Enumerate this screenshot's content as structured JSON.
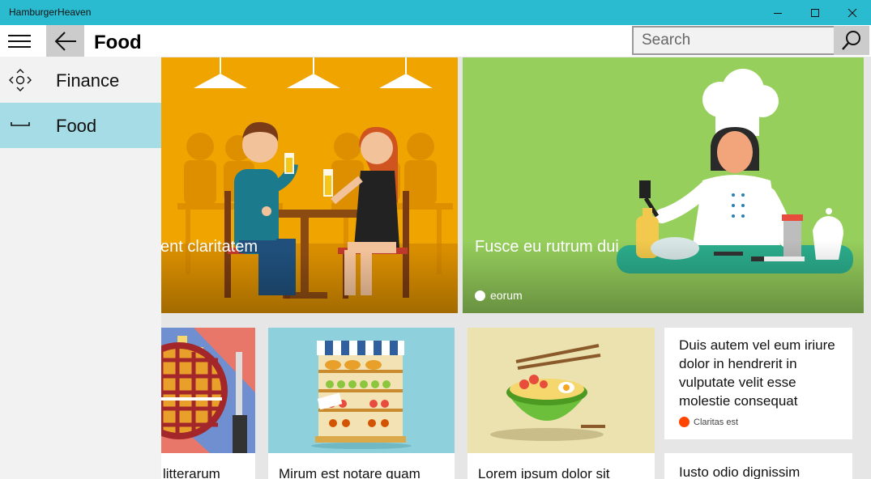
{
  "window": {
    "title": "HamburgerHeaven",
    "controls": {
      "minimize_icon": "minimize-icon",
      "maximize_icon": "maximize-icon",
      "close_icon": "close-icon"
    }
  },
  "header": {
    "title": "Food",
    "search": {
      "placeholder": "Search",
      "value": ""
    }
  },
  "nav": {
    "items": [
      {
        "label": "Finance",
        "icon": "finance-icon",
        "selected": false
      },
      {
        "label": "Food",
        "icon": "food-icon",
        "selected": true
      }
    ]
  },
  "heroes": [
    {
      "caption": "ent claritatem",
      "meta": ""
    },
    {
      "caption": "Fusce eu rutrum dui",
      "meta": "eorum"
    }
  ],
  "tiles": [
    {
      "title": "litterarum"
    },
    {
      "title": "Mirum est notare quam"
    },
    {
      "title": "Lorem ipsum dolor sit"
    },
    {
      "title": "Iusto odio dignissim"
    }
  ],
  "text_card": {
    "body": "Duis autem vel eum iriure dolor in hendrerit in vulputate velit esse molestie consequat",
    "meta": "Claritas est",
    "accent_color": "#ff4500"
  },
  "colors": {
    "titlebar": "#2bbbd1",
    "selected_nav": "#a6dce6",
    "pane": "#f2f2f2"
  }
}
